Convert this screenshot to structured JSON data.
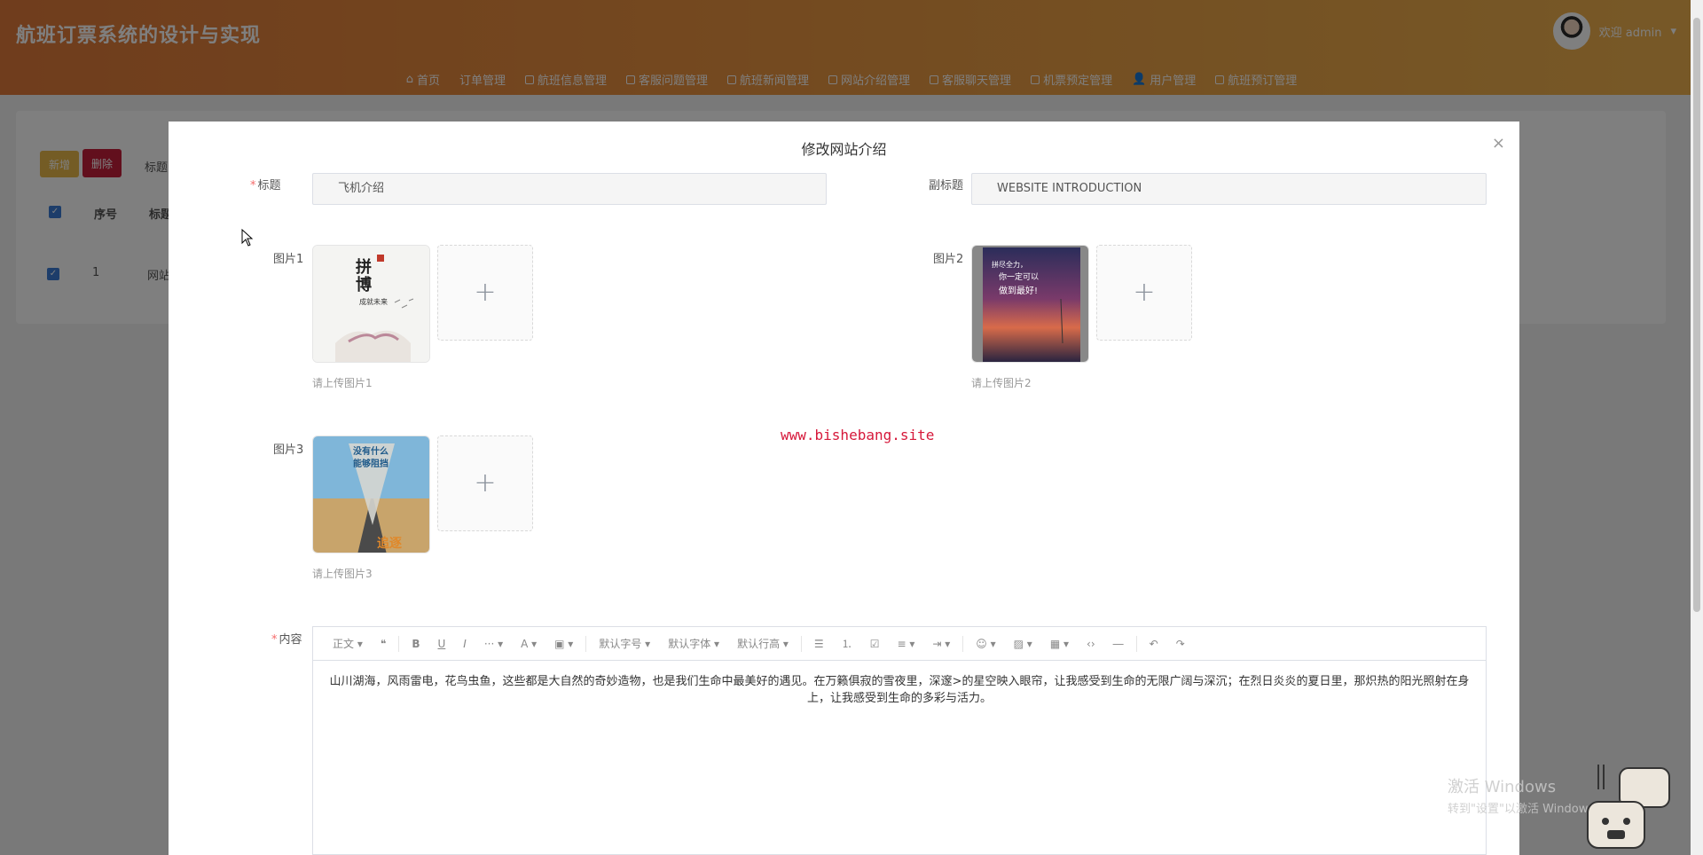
{
  "header": {
    "app_title": "航班订票系统的设计与实现",
    "user_text": "欢迎 admin"
  },
  "nav": [
    {
      "label": "首页",
      "icon": "home-icon"
    },
    {
      "label": "订单管理",
      "icon": ""
    },
    {
      "label": "航班信息管理",
      "icon": "grid-icon"
    },
    {
      "label": "客服问题管理",
      "icon": "grid-icon"
    },
    {
      "label": "航班新闻管理",
      "icon": "grid-icon"
    },
    {
      "label": "网站介绍管理",
      "icon": "grid-icon"
    },
    {
      "label": "客服聊天管理",
      "icon": "grid-icon"
    },
    {
      "label": "机票预定管理",
      "icon": "grid-icon"
    },
    {
      "label": "用户管理",
      "icon": "user-icon"
    },
    {
      "label": "航班预订管理",
      "icon": "grid-icon"
    }
  ],
  "background": {
    "add_label": "新增",
    "delete_label": "删除",
    "filter_label": "标题",
    "col_index": "序号",
    "col_title": "标题",
    "row_index": "1",
    "row_title": "网站"
  },
  "dialog": {
    "title": "修改网站介绍",
    "close": "×",
    "title_label": "标题",
    "title_value": "飞机介绍",
    "subtitle_label": "副标题",
    "subtitle_value": "WEBSITE INTRODUCTION",
    "image1_label": "图片1",
    "image1_hint": "请上传图片1",
    "image2_label": "图片2",
    "image2_hint": "请上传图片2",
    "image3_label": "图片3",
    "image3_hint": "请上传图片3",
    "content_label": "内容",
    "watermark": "www.bishebang.site"
  },
  "editor": {
    "toolbar": {
      "paragraph": "正文",
      "font_size": "默认字号",
      "font_family": "默认字体",
      "line_height": "默认行高"
    },
    "content": "山川湖海，风雨雷电，花鸟虫鱼，这些都是大自然的奇妙造物，也是我们生命中最美好的遇见。在万籁俱寂的雪夜里，深邃>的星空映入眼帘，让我感受到生命的无限广阔与深沉；在烈日炎炎的夏日里，那炽热的阳光照射在身上，让我感受到生命的多彩与活力。"
  },
  "windows": {
    "line1": "激活 Windows",
    "line2": "转到\"设置\"以激活 Windows。"
  }
}
